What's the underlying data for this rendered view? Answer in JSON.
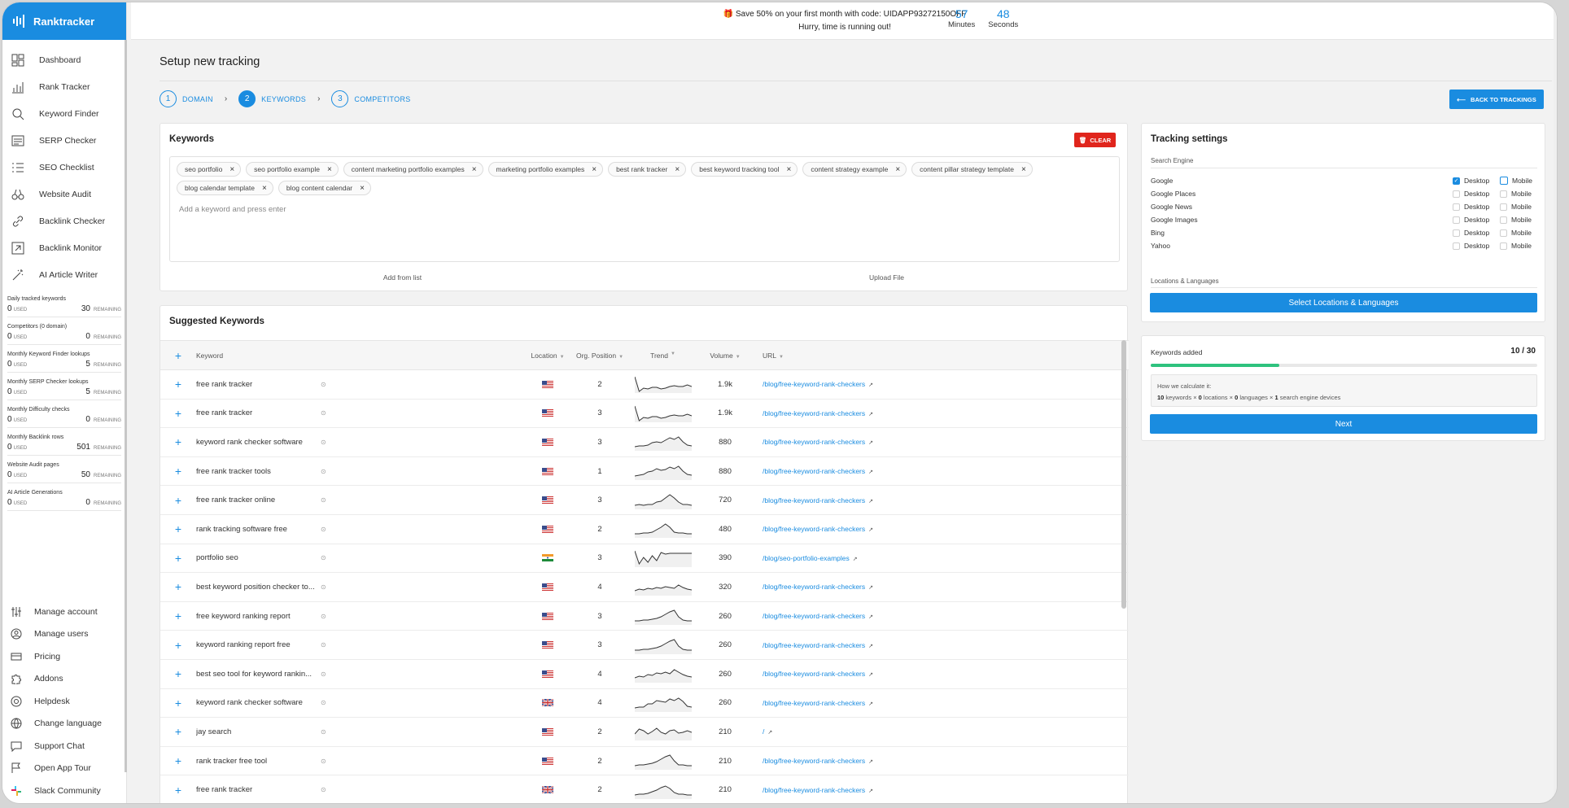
{
  "brand": {
    "name": "Ranktracker"
  },
  "nav": [
    {
      "label": "Dashboard",
      "icon": "dashboard-icon"
    },
    {
      "label": "Rank Tracker",
      "icon": "bar-chart-icon"
    },
    {
      "label": "Keyword Finder",
      "icon": "search-icon"
    },
    {
      "label": "SERP Checker",
      "icon": "serp-icon"
    },
    {
      "label": "SEO Checklist",
      "icon": "checklist-icon"
    },
    {
      "label": "Website Audit",
      "icon": "binoculars-icon"
    },
    {
      "label": "Backlink Checker",
      "icon": "link-icon"
    },
    {
      "label": "Backlink Monitor",
      "icon": "monitor-icon"
    },
    {
      "label": "AI Article Writer",
      "icon": "magic-wand-icon"
    }
  ],
  "usage": [
    {
      "title": "Daily tracked keywords",
      "used": "0",
      "used_label": "USED",
      "remaining": "30",
      "remaining_label": "REMAINING"
    },
    {
      "title": "Competitors (0 domain)",
      "used": "0",
      "used_label": "USED",
      "remaining": "0",
      "remaining_label": "REMAINING"
    },
    {
      "title": "Monthly Keyword Finder lookups",
      "used": "0",
      "used_label": "USED",
      "remaining": "5",
      "remaining_label": "REMAINING"
    },
    {
      "title": "Monthly SERP Checker lookups",
      "used": "0",
      "used_label": "USED",
      "remaining": "5",
      "remaining_label": "REMAINING"
    },
    {
      "title": "Monthly Difficulty checks",
      "used": "0",
      "used_label": "USED",
      "remaining": "0",
      "remaining_label": "REMAINING"
    },
    {
      "title": "Monthly Backlink rows",
      "used": "0",
      "used_label": "USED",
      "remaining": "501",
      "remaining_label": "REMAINING"
    },
    {
      "title": "Website Audit pages",
      "used": "0",
      "used_label": "USED",
      "remaining": "50",
      "remaining_label": "REMAINING"
    },
    {
      "title": "AI Article Generations",
      "used": "0",
      "used_label": "USED",
      "remaining": "0",
      "remaining_label": "REMAINING"
    }
  ],
  "account": [
    {
      "label": "Manage account",
      "icon": "sliders-icon"
    },
    {
      "label": "Manage users",
      "icon": "user-icon"
    },
    {
      "label": "Pricing",
      "icon": "credit-card-icon"
    },
    {
      "label": "Addons",
      "icon": "puzzle-icon"
    },
    {
      "label": "Helpdesk",
      "icon": "lifebuoy-icon"
    },
    {
      "label": "Change language",
      "icon": "globe-icon"
    },
    {
      "label": "Support Chat",
      "icon": "chat-icon"
    },
    {
      "label": "Open App Tour",
      "icon": "flag-icon"
    },
    {
      "label": "Slack Community",
      "icon": "slack-icon"
    }
  ],
  "promo": {
    "line1": "Save 50% on your first month with code: UIDAPP93272150OFF",
    "line2": "Hurry, time is running out!",
    "minutes": "57",
    "minutes_label": "Minutes",
    "seconds": "48",
    "seconds_label": "Seconds"
  },
  "page": {
    "title": "Setup new tracking",
    "back": "BACK TO TRACKINGS"
  },
  "steps": [
    {
      "num": "1",
      "label": "DOMAIN",
      "active": false
    },
    {
      "num": "2",
      "label": "KEYWORDS",
      "active": true
    },
    {
      "num": "3",
      "label": "COMPETITORS",
      "active": false
    }
  ],
  "keywords_card": {
    "title": "Keywords",
    "clear": "CLEAR",
    "chips": [
      "seo portfolio",
      "seo portfolio example",
      "content marketing portfolio examples",
      "marketing portfolio examples",
      "best rank tracker",
      "best keyword tracking tool",
      "content strategy example",
      "content pillar strategy template",
      "blog calendar template",
      "blog content calendar"
    ],
    "placeholder": "Add a keyword and press enter",
    "add_from_list": "Add from list",
    "upload_file": "Upload File"
  },
  "suggested": {
    "title": "Suggested Keywords",
    "columns": {
      "keyword": "Keyword",
      "location": "Location",
      "position": "Org. Position",
      "trend": "Trend",
      "volume": "Volume",
      "url": "URL"
    },
    "rows": [
      {
        "keyword": "free rank tracker",
        "flag": "us",
        "position": "2",
        "volume": "1.9k",
        "url": "/blog/free-keyword-rank-checkers",
        "trend": [
          2,
          20,
          16,
          17,
          15,
          15,
          17,
          16,
          14,
          13,
          14,
          14,
          12,
          14
        ]
      },
      {
        "keyword": "free rank tracker",
        "flag": "us",
        "position": "3",
        "volume": "1.9k",
        "url": "/blog/free-keyword-rank-checkers",
        "trend": [
          2,
          20,
          16,
          17,
          15,
          15,
          17,
          16,
          14,
          13,
          14,
          14,
          12,
          14
        ]
      },
      {
        "keyword": "keyword rank checker software",
        "flag": "us",
        "position": "3",
        "volume": "880",
        "url": "/blog/free-keyword-rank-checkers",
        "trend": [
          17,
          16,
          16,
          15,
          12,
          11,
          12,
          9,
          6,
          8,
          5,
          11,
          15,
          16
        ]
      },
      {
        "keyword": "free rank tracker tools",
        "flag": "us",
        "position": "1",
        "volume": "880",
        "url": "/blog/free-keyword-rank-checkers",
        "trend": [
          17,
          16,
          15,
          12,
          11,
          8,
          10,
          9,
          6,
          8,
          5,
          11,
          15,
          16
        ]
      },
      {
        "keyword": "free rank tracker online",
        "flag": "us",
        "position": "3",
        "volume": "720",
        "url": "/blog/free-keyword-rank-checkers",
        "trend": [
          17,
          16,
          17,
          16,
          16,
          13,
          12,
          8,
          4,
          8,
          13,
          16,
          16,
          17
        ]
      },
      {
        "keyword": "rank tracking software free",
        "flag": "us",
        "position": "2",
        "volume": "480",
        "url": "/blog/free-keyword-rank-checkers",
        "trend": [
          17,
          17,
          16,
          16,
          15,
          12,
          9,
          5,
          9,
          15,
          16,
          16,
          17,
          17
        ]
      },
      {
        "keyword": "portfolio seo",
        "flag": "in",
        "position": "3",
        "volume": "390",
        "url": "/blog/seo-portfolio-examples",
        "trend": [
          2,
          18,
          10,
          16,
          8,
          14,
          4,
          6,
          5,
          5,
          5,
          5,
          5,
          5
        ]
      },
      {
        "keyword": "best keyword position checker to...",
        "flag": "us",
        "position": "4",
        "volume": "320",
        "url": "/blog/free-keyword-rank-checkers",
        "trend": [
          16,
          14,
          15,
          13,
          14,
          12,
          13,
          11,
          12,
          13,
          9,
          12,
          14,
          15
        ]
      },
      {
        "keyword": "free keyword ranking report",
        "flag": "us",
        "position": "3",
        "volume": "260",
        "url": "/blog/free-keyword-rank-checkers",
        "trend": [
          17,
          17,
          16,
          16,
          15,
          14,
          12,
          9,
          6,
          4,
          12,
          16,
          17,
          17
        ]
      },
      {
        "keyword": "keyword ranking report free",
        "flag": "us",
        "position": "3",
        "volume": "260",
        "url": "/blog/free-keyword-rank-checkers",
        "trend": [
          17,
          17,
          16,
          16,
          15,
          14,
          12,
          9,
          6,
          4,
          12,
          16,
          17,
          17
        ]
      },
      {
        "keyword": "best seo tool for keyword rankin...",
        "flag": "us",
        "position": "4",
        "volume": "260",
        "url": "/blog/free-keyword-rank-checkers",
        "trend": [
          16,
          14,
          15,
          12,
          13,
          10,
          11,
          9,
          11,
          6,
          9,
          12,
          14,
          15
        ]
      },
      {
        "keyword": "keyword rank checker software",
        "flag": "gb",
        "position": "4",
        "volume": "260",
        "url": "/blog/free-keyword-rank-checkers",
        "trend": [
          17,
          16,
          16,
          12,
          12,
          8,
          9,
          10,
          6,
          8,
          5,
          9,
          15,
          16
        ]
      },
      {
        "keyword": "jay search",
        "flag": "us",
        "position": "2",
        "volume": "210",
        "url": "/",
        "trend": [
          14,
          8,
          10,
          14,
          11,
          7,
          12,
          14,
          10,
          9,
          13,
          12,
          10,
          12
        ]
      },
      {
        "keyword": "rank tracker free tool",
        "flag": "us",
        "position": "2",
        "volume": "210",
        "url": "/blog/free-keyword-rank-checkers",
        "trend": [
          17,
          16,
          16,
          15,
          14,
          12,
          9,
          6,
          4,
          11,
          16,
          16,
          17,
          17
        ]
      },
      {
        "keyword": "free rank tracker",
        "flag": "gb",
        "position": "2",
        "volume": "210",
        "url": "/blog/free-keyword-rank-checkers",
        "trend": [
          17,
          16,
          16,
          15,
          13,
          11,
          8,
          6,
          9,
          14,
          16,
          16,
          17,
          17
        ]
      }
    ]
  },
  "tracking": {
    "title": "Tracking settings",
    "search_engine_label": "Search Engine",
    "desktop": "Desktop",
    "mobile": "Mobile",
    "engines": [
      {
        "name": "Google",
        "desktop": true,
        "mobile": false
      },
      {
        "name": "Google Places",
        "desktop": false,
        "mobile": false
      },
      {
        "name": "Google News",
        "desktop": false,
        "mobile": false
      },
      {
        "name": "Google Images",
        "desktop": false,
        "mobile": false
      },
      {
        "name": "Bing",
        "desktop": false,
        "mobile": false
      },
      {
        "name": "Yahoo",
        "desktop": false,
        "mobile": false
      }
    ],
    "locations_label": "Locations & Languages",
    "locations_button": "Select Locations & Languages"
  },
  "added": {
    "title": "Keywords added",
    "count": "10 / 30",
    "progress": 0.333,
    "calc_title": "How we calculate it:",
    "calc_keywords": "10",
    "calc_locations": "0",
    "calc_languages": "0",
    "calc_devices": "1",
    "next": "Next"
  },
  "colors": {
    "accent": "#1a8ce0",
    "danger": "#e0251c",
    "progress": "#2ec27e"
  }
}
